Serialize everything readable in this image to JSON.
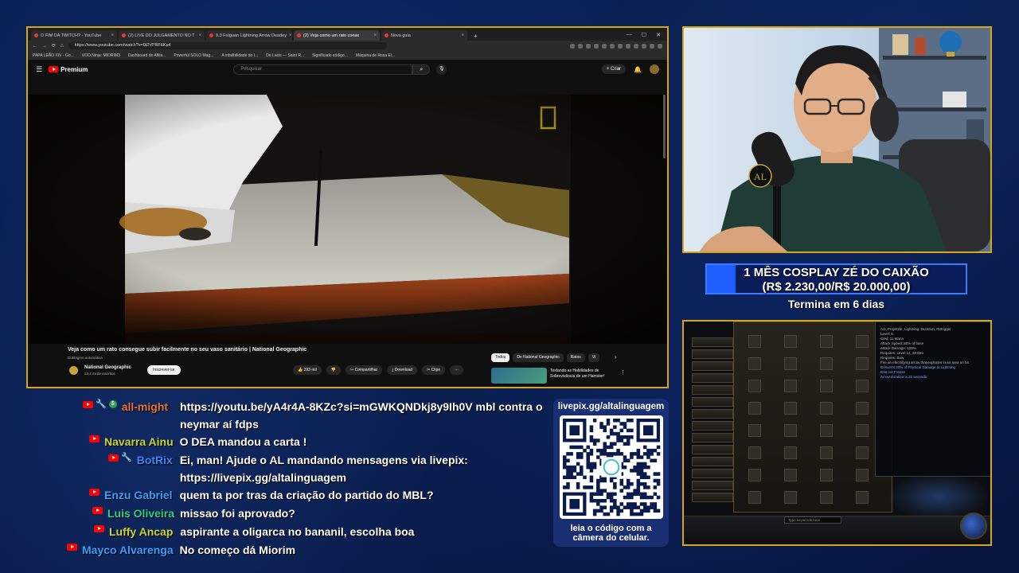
{
  "browser": {
    "tabs": [
      {
        "label": "O FIM DA TWITCH? - YouTube",
        "active": false
      },
      {
        "label": "(2) LIVE DO JULGAMENTO NO T",
        "active": false
      },
      {
        "label": "0.3 Fulguan Lightning Arrow Deadey",
        "active": false
      },
      {
        "label": "(2) Veja como um rato conse",
        "active": true
      },
      {
        "label": "Nova guia",
        "active": false
      }
    ],
    "url": "https://www.youtube.com/watch?v=0t2VPBF6Kp4",
    "bookmarks": [
      "PAPA LEÃO XIV - Go...",
      "VOO.Ninja: MIORIM3",
      "Dashboard do Afilia...",
      "Powerful SOLO Mag...",
      "A infalibilidade do I...",
      "De Lacis — Saint R...",
      "Significado código...",
      "Máquina de Rosa El..."
    ]
  },
  "youtube": {
    "logo": "Premium",
    "search_placeholder": "Pesquisar",
    "create_label": "Criar",
    "video_title": "Veja como um rato consegue subir facilmente no seu vaso sanitário | National Geographic",
    "dubbing": "Dublagem automática",
    "channel": "National Geographic",
    "subscribers": "23,4 mi de inscritos",
    "subscribe_label": "Inscrever-se",
    "likes": "293 mil",
    "share": "Compartilhar",
    "download": "Download",
    "clip": "Clipe",
    "chips": [
      "Todos",
      "De National Geographic",
      "Ratos",
      "Vi"
    ],
    "rec_title": "Testando as Habilidades de Sobrevivência de um Hamster!"
  },
  "goal": {
    "title": "1 MÊS COSPLAY ZÉ DO CAIXÃO",
    "amount": "(R$ 2.230,00/R$ 20.000,00)",
    "progress": 0.1115,
    "ends": "Termina em 6 dias"
  },
  "game": {
    "search_placeholder": "Type keywords here",
    "panel_lines": [
      "Act, Projectile, Lightning, Duration, Retrigger",
      "Level: 5",
      "Cost: 11 Mana",
      "Attack Speed: 80% of base",
      "Attack Damage: 128%",
      "Requires: Level 14, 38 Dex",
      "Requires: Bow",
      "Fire an electrifying arrow that explodes in an area on hit.",
      "Converts 30% of Physical Damage to Lightning",
      "Can not Freeze",
      "Arrow duration is 25 seconds"
    ]
  },
  "chat": [
    {
      "user": "all-might",
      "color": "#e8733a",
      "badges": [
        "yt",
        "wrench",
        "green"
      ],
      "text": "https://youtu.be/yA4r4A-8KZc?si=mGWKQNDkj8y9Ih0V mbl contra o neymar aí fdps"
    },
    {
      "user": "Navarra Ainu",
      "color": "#c9d33a",
      "badges": [
        "yt"
      ],
      "text": "O DEA mandou a carta !"
    },
    {
      "user": "BotRix",
      "color": "#3a86ff",
      "badges": [
        "yt",
        "wrench"
      ],
      "text": "Ei, man! Ajude o AL mandando mensagens via livepix: https://livepix.gg/altalinguagem"
    },
    {
      "user": "Enzu Gabriel",
      "color": "#3aa0ff",
      "badges": [
        "yt"
      ],
      "text": "quem ta por tras da criação do partido do MBL?"
    },
    {
      "user": "Luis Oliveira",
      "color": "#2ecf8a",
      "badges": [
        "yt"
      ],
      "text": "missao foi aprovado?"
    },
    {
      "user": "Luffy Ancap",
      "color": "#c9d33a",
      "badges": [
        "yt"
      ],
      "text": "aspirante a oligarca no bananil, escolha boa"
    },
    {
      "user": "Mayco Alvarenga",
      "color": "#3aa0ff",
      "badges": [
        "yt"
      ],
      "text": "No começo dá Miorim"
    }
  ],
  "livepix": {
    "title": "livepix.gg/altalinguagem",
    "footer_line1": "leia o código com a",
    "footer_line2": "câmera do celular."
  }
}
